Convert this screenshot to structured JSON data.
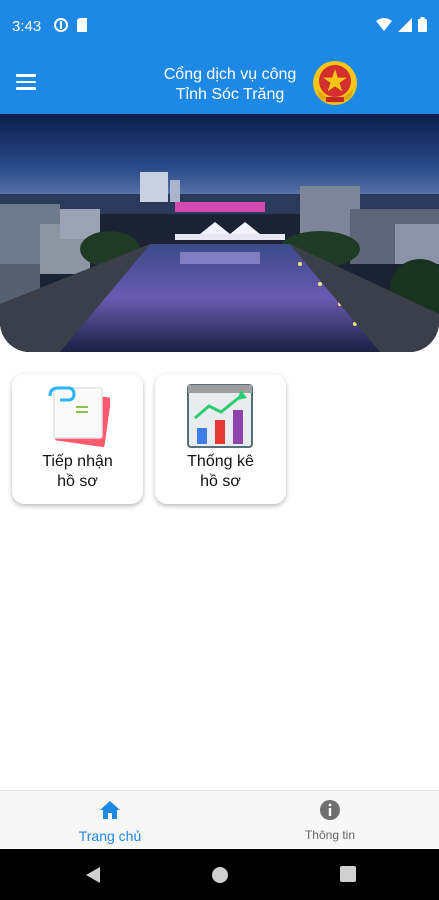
{
  "status_bar": {
    "time": "3:43",
    "left_icons": [
      "data-saver-icon",
      "sd-card-icon"
    ],
    "right_icons": [
      "wifi-icon",
      "cellular-signal-icon",
      "battery-icon"
    ]
  },
  "app_bar": {
    "title_line1": "Cổng dịch vụ công",
    "title_line2": "Tỉnh Sóc Trăng",
    "menu_icon": "hamburger-menu-icon",
    "emblem_icon": "national-emblem-icon"
  },
  "banner": {
    "image": "city-river-night-photo"
  },
  "tiles": [
    {
      "line1": "Tiếp nhận",
      "line2": "hồ sơ",
      "icon": "documents-icon"
    },
    {
      "line1": "Thống kê",
      "line2": "hồ sơ",
      "icon": "bar-chart-icon"
    }
  ],
  "bottom_nav": {
    "home_label": "Trang chủ",
    "info_label": "Thông tin",
    "active": "home"
  },
  "colors": {
    "primary": "#1e88e5",
    "nav_active": "#1e88e5",
    "nav_inactive": "#666666"
  }
}
